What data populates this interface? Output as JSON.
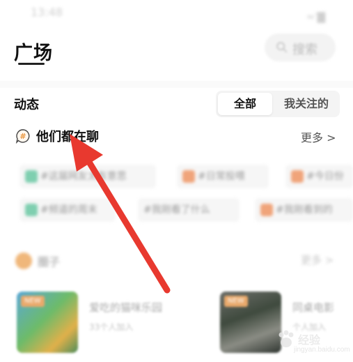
{
  "status_bar": {
    "time": "13:48",
    "icons": "≈༌▇"
  },
  "header": {
    "title": "广场",
    "search_label": "搜索"
  },
  "feed": {
    "title": "动态",
    "tabs": [
      {
        "label": "全部",
        "active": true
      },
      {
        "label": "我关注的",
        "active": false
      }
    ]
  },
  "topics": {
    "title": "他们都在聊",
    "more": "更多 >",
    "chips_row1": [
      {
        "text": "#这届网友太有意思",
        "color": "#7fcfb0"
      },
      {
        "text": "#日常投喂",
        "color": "#f0a47a"
      },
      {
        "text": "#今日份",
        "color": "#f0a47a"
      }
    ],
    "chips_row2": [
      {
        "text": "#频道的周末",
        "color": "#7fcfb0"
      },
      {
        "text": "#我刚看了什么",
        "color": ""
      },
      {
        "text": "#我刚看到的",
        "color": "#f0a47a"
      }
    ]
  },
  "circles": {
    "title": "圈子",
    "more": "更多 >",
    "cards": [
      {
        "badge": "NEW",
        "name": "爱吃的猫咪乐园",
        "count": "33个人加入"
      },
      {
        "badge": "NEW",
        "name": "同桌电影",
        "count": "个人加入"
      }
    ]
  },
  "watermark": {
    "brand": "经验",
    "url": "jingyan.baidu.com"
  },
  "colors": {
    "arrow": "#e8392f",
    "accent": "#f0a47a"
  }
}
